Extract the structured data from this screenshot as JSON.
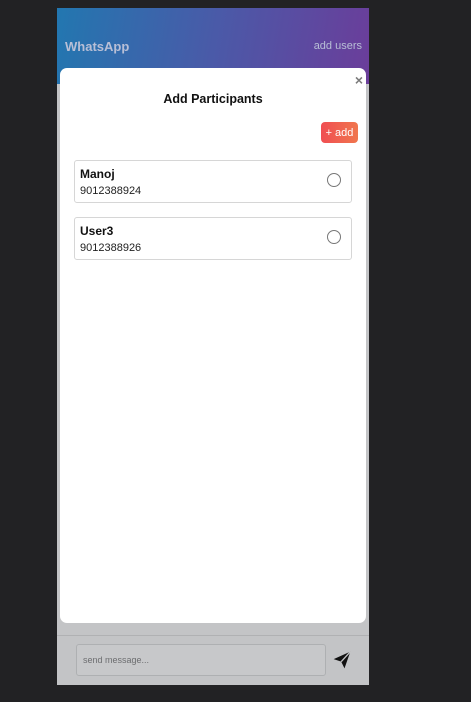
{
  "header": {
    "title": "WhatsApp",
    "add_users_label": "add users"
  },
  "modal": {
    "title": "Add Participants",
    "close_label": "×",
    "add_button_label": "+ add",
    "participants": [
      {
        "name": "Manoj",
        "phone": "9012388924",
        "selected": false
      },
      {
        "name": "User3",
        "phone": "9012388926",
        "selected": false
      }
    ]
  },
  "footer": {
    "message_placeholder": "send message...",
    "send_icon": "send-icon"
  }
}
